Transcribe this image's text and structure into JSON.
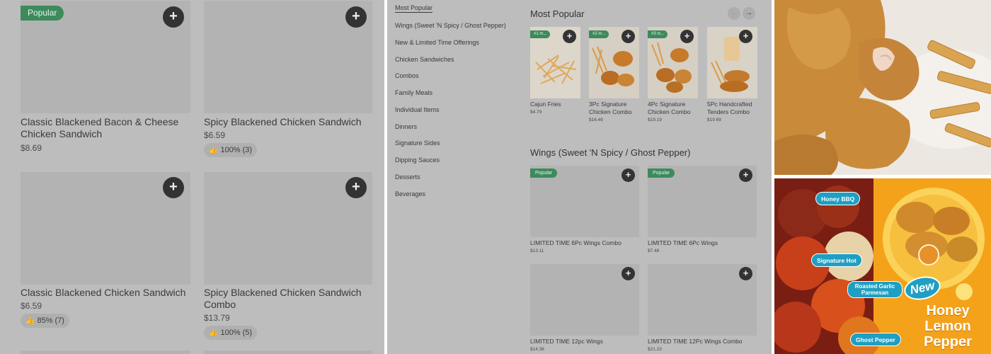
{
  "panel1": {
    "popular_badge": "Popular",
    "add_symbol": "+",
    "thumb_icon": "thumbs-up-icon",
    "cards": [
      {
        "name": "Classic Blackened Bacon & Cheese Chicken Sandwich",
        "price": "$8.69",
        "rating": ""
      },
      {
        "name": "Spicy Blackened Chicken Sandwich",
        "price": "$6.59",
        "rating": "100% (3)"
      },
      {
        "name": "Classic Blackened Chicken Sandwich",
        "price": "$6.59",
        "rating": "85% (7)"
      },
      {
        "name": "Spicy Blackened Chicken Sandwich Combo",
        "price": "$13.79",
        "rating": "100% (5)"
      }
    ]
  },
  "panel2": {
    "nav": [
      "Most Popular",
      "Wings (Sweet 'N Spicy / Ghost Pepper)",
      "New & Limited Time Offerings",
      "Chicken Sandwiches",
      "Combos",
      "Family Meals",
      "Individual Items",
      "Dinners",
      "Signature Sides",
      "Dipping Sauces",
      "Desserts",
      "Beverages"
    ],
    "most_popular_title": "Most Popular",
    "prev_arrow": "←",
    "next_arrow": "→",
    "most_popular": [
      {
        "rank": "#1 m...",
        "name": "Cajun Fries",
        "price": "$4.79"
      },
      {
        "rank": "#2 m...",
        "name": "3Pc Signature Chicken Combo",
        "price": "$16.49"
      },
      {
        "rank": "#3 m...",
        "name": "4Pc Signature Chicken Combo",
        "price": "$19.19"
      },
      {
        "rank": "",
        "name": "5Pc Handcrafted Tenders Combo",
        "price": "$19.69"
      }
    ],
    "wings_title": "Wings (Sweet 'N Spicy / Ghost Pepper)",
    "wings": [
      {
        "badge": "Popular",
        "name": "LIMITED TIME 6Pc Wings Combo",
        "price": "$13.11"
      },
      {
        "badge": "Popular",
        "name": "LIMITED TIME 6Pc Wings",
        "price": "$7.48"
      },
      {
        "badge": "",
        "name": "LIMITED TIME 12pc Wings",
        "price": "$14.36"
      },
      {
        "badge": "",
        "name": "LIMITED TIME 12Pc Wings Combo",
        "price": "$21.23"
      }
    ]
  },
  "panel4": {
    "flavors": [
      "Honey BBQ",
      "Signature Hot",
      "Roasted Garlic Parmesan",
      "Ghost Pepper"
    ],
    "new_badge": "New",
    "headline": "Honey Lemon Pepper"
  }
}
